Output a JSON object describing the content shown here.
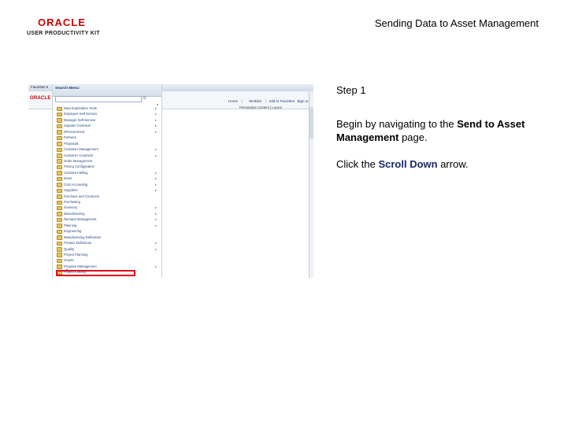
{
  "header": {
    "logo_main": "ORACLE",
    "logo_sub": "USER PRODUCTIVITY KIT",
    "doc_title": "Sending Data to Asset Management"
  },
  "screenshot": {
    "topbar": [
      "Favorites ▾",
      "Main Menu ▾"
    ],
    "oracle_mini": "ORACLE",
    "nav_links": [
      "Home",
      "Worklist",
      "Add to Favorites",
      "Sign out"
    ],
    "personalize": "Personalize Content | Layout",
    "menu_title": "Search Menu:",
    "search_go": "⊙",
    "collapse_arrow": "▾",
    "menu_items": [
      {
        "label": "Data Exploration Tools",
        "arrow": "▸"
      },
      {
        "label": "Employee Self-Service",
        "arrow": "▸"
      },
      {
        "label": "Manager Self-Service",
        "arrow": "▸"
      },
      {
        "label": "Supplier Contracts",
        "arrow": "▸"
      },
      {
        "label": "eProcurement",
        "arrow": "▸"
      },
      {
        "label": "Partners",
        "arrow": ""
      },
      {
        "label": "Proposals",
        "arrow": ""
      },
      {
        "label": "Customer Management",
        "arrow": "▸"
      },
      {
        "label": "Customer Contracts",
        "arrow": "▸"
      },
      {
        "label": "Order Management",
        "arrow": ""
      },
      {
        "label": "Pricing Configuration",
        "arrow": ""
      },
      {
        "label": "Customer Billing",
        "arrow": "▸"
      },
      {
        "label": "Items",
        "arrow": "▸"
      },
      {
        "label": "Cost Accounting",
        "arrow": "▸"
      },
      {
        "label": "Suppliers",
        "arrow": "▸"
      },
      {
        "label": "Purchase and Contracts",
        "arrow": ""
      },
      {
        "label": "Purchasing",
        "arrow": ""
      },
      {
        "label": "Inventory",
        "arrow": "▸"
      },
      {
        "label": "Manufacturing",
        "arrow": "▸"
      },
      {
        "label": "Demand Management",
        "arrow": "▸"
      },
      {
        "label": "Planning",
        "arrow": "▸"
      },
      {
        "label": "Engineering",
        "arrow": ""
      },
      {
        "label": "Manufacturing Definitions",
        "arrow": ""
      },
      {
        "label": "Product Definitions",
        "arrow": "▸"
      },
      {
        "label": "Quality",
        "arrow": "▸"
      },
      {
        "label": "Project Planning",
        "arrow": ""
      },
      {
        "label": "Grants",
        "arrow": ""
      },
      {
        "label": "Program Management",
        "arrow": "▸"
      },
      {
        "label": "Project Costing",
        "arrow": ""
      }
    ],
    "scroll_down_arrow": "▾"
  },
  "instructions": {
    "step": "Step 1",
    "line1_prefix": "Begin by navigating to the ",
    "line1_bold": "Send to Asset Management",
    "line1_suffix": " page.",
    "line2_prefix": "Click the ",
    "line2_bold": "Scroll Down",
    "line2_suffix": " arrow."
  }
}
